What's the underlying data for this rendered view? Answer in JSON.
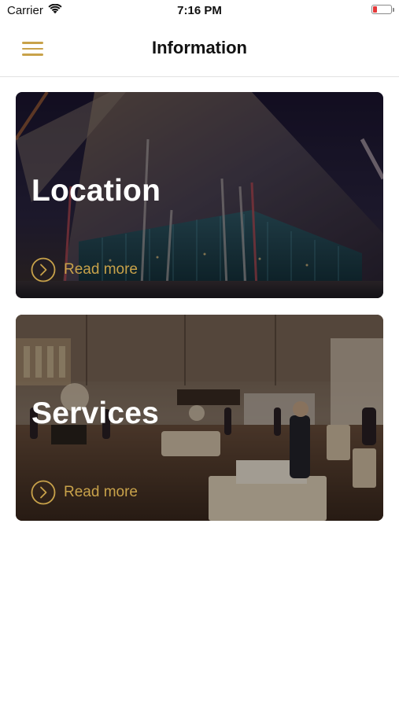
{
  "status_bar": {
    "carrier": "Carrier",
    "time": "7:16 PM",
    "battery_level": 0.2,
    "battery_color": "#e5393a"
  },
  "nav": {
    "title": "Information",
    "menu_icon": "hamburger-menu-icon"
  },
  "colors": {
    "accent": "#c8a24a",
    "title_text": "#111111",
    "card_title": "#ffffff"
  },
  "cards": [
    {
      "title": "Location",
      "read_more": "Read more",
      "icon": "chevron-right-circle-icon"
    },
    {
      "title": "Services",
      "read_more": "Read more",
      "icon": "chevron-right-circle-icon"
    }
  ]
}
